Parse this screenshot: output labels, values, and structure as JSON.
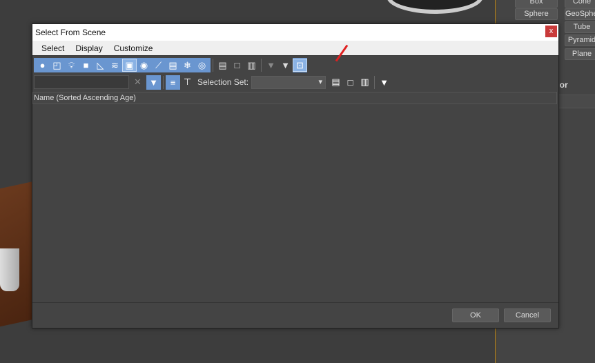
{
  "dialog": {
    "title": "Select From Scene",
    "close": "x",
    "menu": [
      "Select",
      "Display",
      "Customize"
    ],
    "toolbar1": [
      "circle-icon",
      "shapes-icon",
      "bulb-icon",
      "camera-icon",
      "helper-icon",
      "spacewarp-icon",
      "group-icon",
      "xref-icon",
      "bone-icon",
      "container-icon",
      "frozen-icon",
      "hidden-icon",
      "select-all-icon",
      "select-none-icon",
      "invert-icon",
      "filter-off-icon",
      "filter-icon",
      "display-children-icon"
    ],
    "selection_set_label": "Selection Set:",
    "selection_set_value": "",
    "search_value": "",
    "column_header": "Name (Sorted Ascending Age)",
    "ok": "OK",
    "cancel": "Cancel"
  },
  "panel": {
    "buttons": [
      "Box",
      "Cone",
      "Sphere",
      "GeoSphere",
      "Tube",
      "Pyramid",
      "Plane"
    ],
    "section_label": "olor"
  },
  "colors": {
    "accent": "#6a96d0",
    "close": "#c93a3a"
  }
}
